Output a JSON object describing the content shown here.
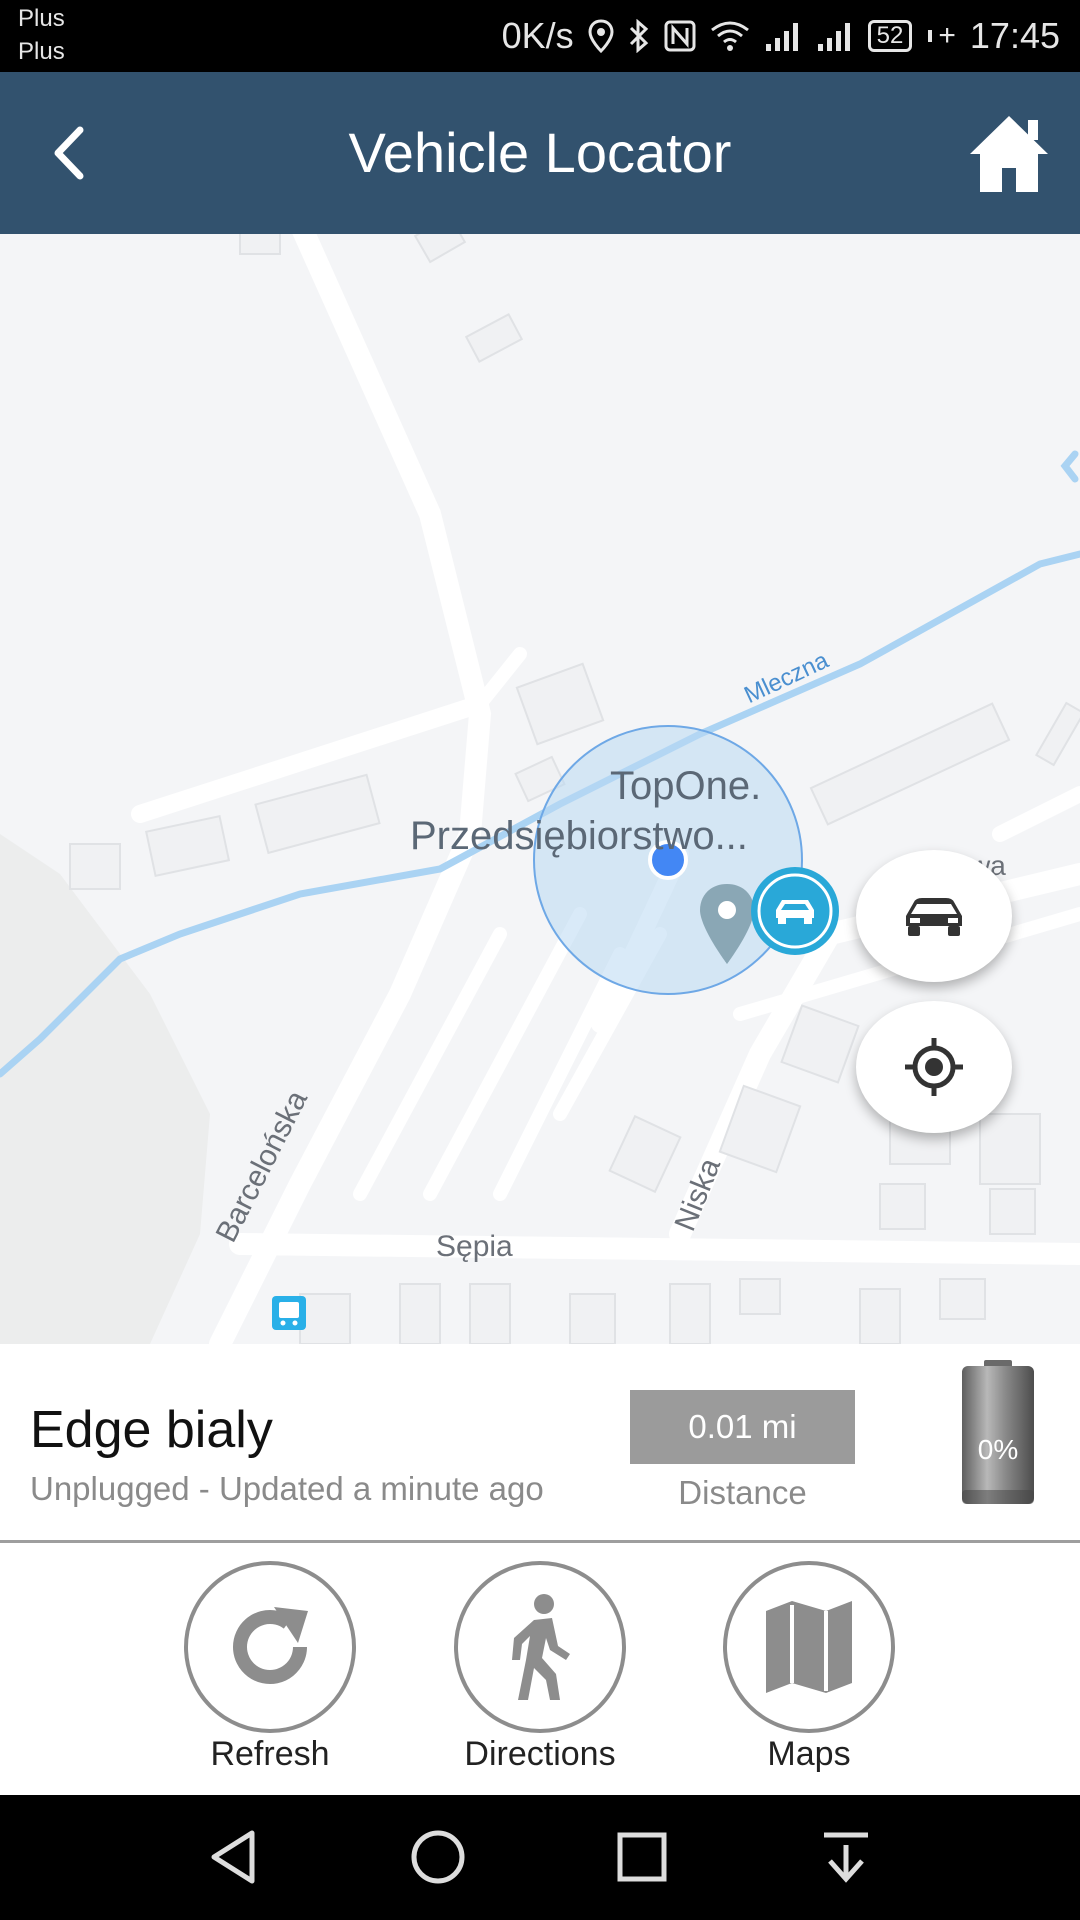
{
  "status_bar": {
    "carrier_1": "Plus",
    "carrier_2": "Plus",
    "net_speed": "0K/s",
    "battery": "52",
    "time": "17:45"
  },
  "header": {
    "title": "Vehicle Locator",
    "back_icon": "back-arrow-icon",
    "home_icon": "home-icon"
  },
  "map": {
    "streets": [
      "Mleczna",
      "Barcelońska",
      "Sępia",
      "Niska",
      "wa"
    ],
    "poi_line_1": "TopOne.",
    "poi_line_2": "Przedsiębiorstwo...",
    "fab_vehicle_icon": "car-icon",
    "fab_locate_icon": "crosshair-icon"
  },
  "vehicle": {
    "name": "Edge bialy",
    "status": "Unplugged - Updated a minute ago",
    "distance_value": "0.01 mi",
    "distance_label": "Distance",
    "battery_percent": "0%"
  },
  "actions": [
    {
      "label": "Refresh",
      "icon": "refresh-icon"
    },
    {
      "label": "Directions",
      "icon": "walking-icon"
    },
    {
      "label": "Maps",
      "icon": "map-icon"
    }
  ],
  "colors": {
    "header": "#32526e",
    "accent": "#29a8d8",
    "action_gray": "#8d8d8d"
  }
}
